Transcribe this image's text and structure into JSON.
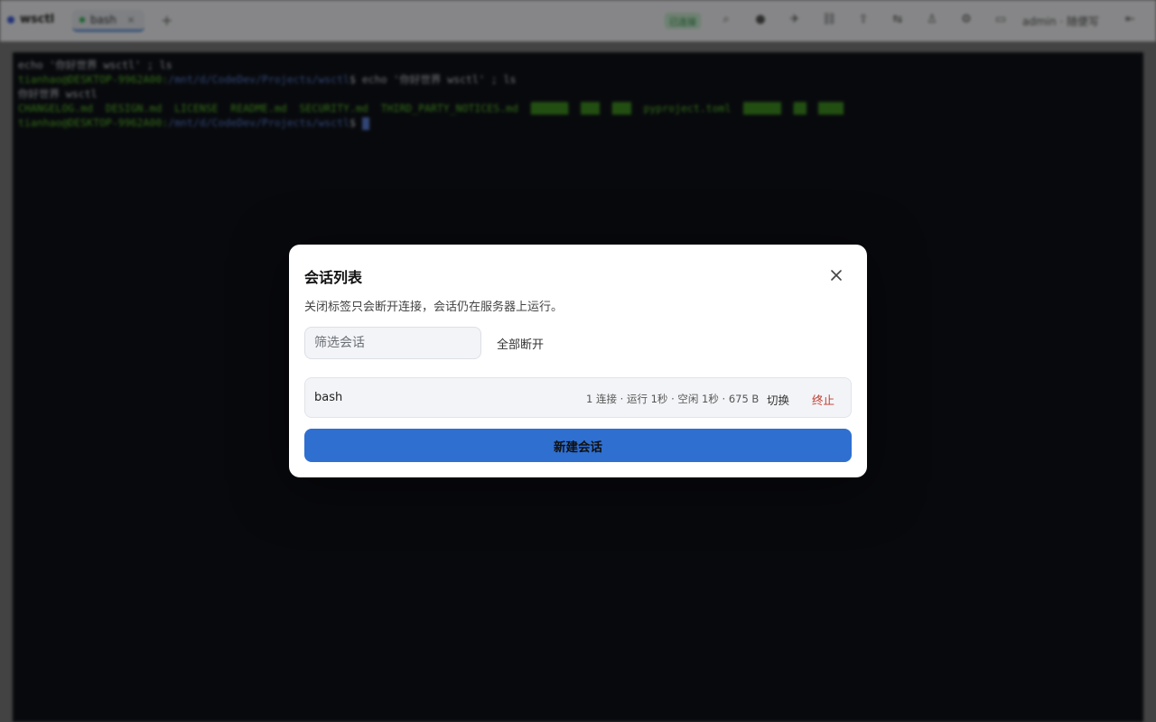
{
  "app": {
    "brand": "wsctl",
    "tab_label": "bash",
    "tab_close": "×",
    "tab_add": "+",
    "status": "已连接",
    "user": "admin · 随便写",
    "accent": "#2f6fd0"
  },
  "terminal": {
    "line1": "echo '你好世界 wsctl' ; ls",
    "line2_prompt": "tianhao@DESKTOP-9962A00:",
    "line2_path": "/mnt/d/CodeDev/Projects/wsctl",
    "line2_cmd": "$ echo '你好世界 wsctl' ; ls",
    "line3": "你好世界 wsctl",
    "line4": "CHANGELOG.md  DESIGN.md  LICENSE  README.md  SECURITY.md  THIRD_PARTY_NOTICES.md",
    "line4_tail": "pyproject.toml",
    "line5_prompt": "tianhao@DESKTOP-9962A00:",
    "line5_path": "/mnt/d/CodeDev/Projects/wsctl",
    "line5_cmd": "$ "
  },
  "modal": {
    "title": "会话列表",
    "description": "关闭标签只会断开连接，会话仍在服务器上运行。",
    "filter_placeholder": "筛选会话",
    "disconnect_all": "全部断开",
    "sessions": [
      {
        "name": "bash",
        "meta": "1 连接 · 运行 1秒 · 空闲 1秒 · 675 B",
        "switch_label": "切换",
        "kill_label": "终止"
      }
    ],
    "new_session": "新建会话",
    "close_icon": "close-icon",
    "kill_color": "#c0392b"
  }
}
